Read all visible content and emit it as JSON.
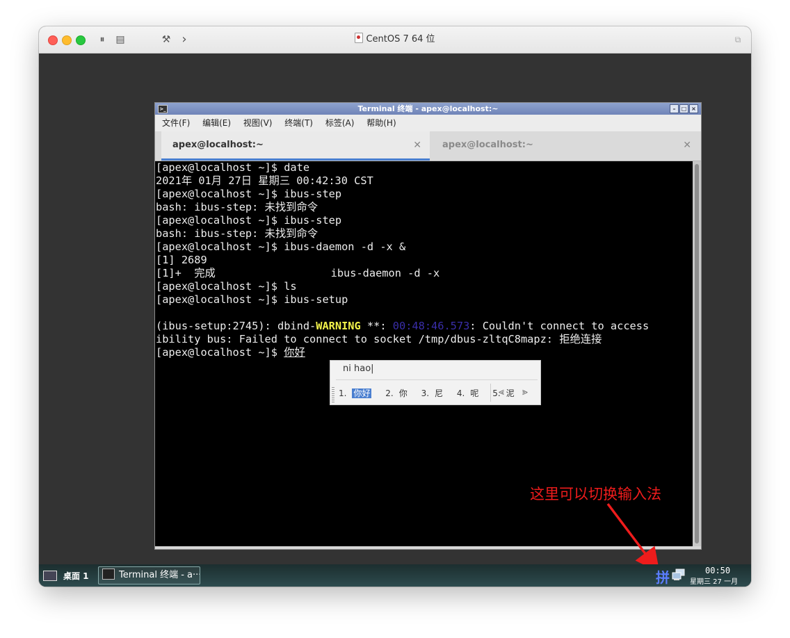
{
  "host_window": {
    "title": "CentOS 7 64 位"
  },
  "terminal": {
    "title": "Terminal 终端 - apex@localhost:~",
    "menu": [
      "文件(F)",
      "编辑(E)",
      "视图(V)",
      "终端(T)",
      "标签(A)",
      "帮助(H)"
    ],
    "tabs": [
      {
        "label": "apex@localhost:~",
        "active": true
      },
      {
        "label": "apex@localhost:~",
        "active": false
      }
    ],
    "lines": [
      "[apex@localhost ~]$ date",
      "2021年 01月 27日 星期三 00:42:30 CST",
      "[apex@localhost ~]$ ibus-step",
      "bash: ibus-step: 未找到命令",
      "[apex@localhost ~]$ ibus-step",
      "bash: ibus-step: 未找到命令",
      "[apex@localhost ~]$ ibus-daemon -d -x &",
      "[1] 2689",
      "[1]+  完成                  ibus-daemon -d -x",
      "[apex@localhost ~]$ ls",
      "[apex@localhost ~]$ ibus-setup",
      "",
      "",
      "ibility bus: Failed to connect to socket /tmp/dbus-zltqC8mapz: 拒绝连接",
      ""
    ],
    "warning_line": {
      "prefix": "(ibus-setup:2745): dbind-",
      "level": "WARNING",
      "sep": " **: ",
      "timestamp": "00:48:46.573",
      "message": ": Couldn't connect to access"
    },
    "prompt_line": {
      "prompt": "[apex@localhost ~]$ ",
      "input": "你好"
    }
  },
  "ime_popup": {
    "preedit": "ni hao|",
    "candidates": [
      {
        "index": "1.",
        "text": "你好",
        "selected": true
      },
      {
        "index": "2.",
        "text": "你",
        "selected": false
      },
      {
        "index": "3.",
        "text": "尼",
        "selected": false
      },
      {
        "index": "4.",
        "text": "呢",
        "selected": false
      },
      {
        "index": "5.",
        "text": "泥",
        "selected": false
      }
    ],
    "prev_icon": "chevron-left-icon",
    "next_icon": "chevron-right-icon"
  },
  "annotation": {
    "text": "这里可以切换输入法",
    "color": "#ee1c1c"
  },
  "taskbar": {
    "desktop_label": "桌面 1",
    "task_label": "Terminal 终端 - a···",
    "ime_indicator": "拼",
    "clock_time": "00:50",
    "clock_date": "星期三 27 一月"
  }
}
